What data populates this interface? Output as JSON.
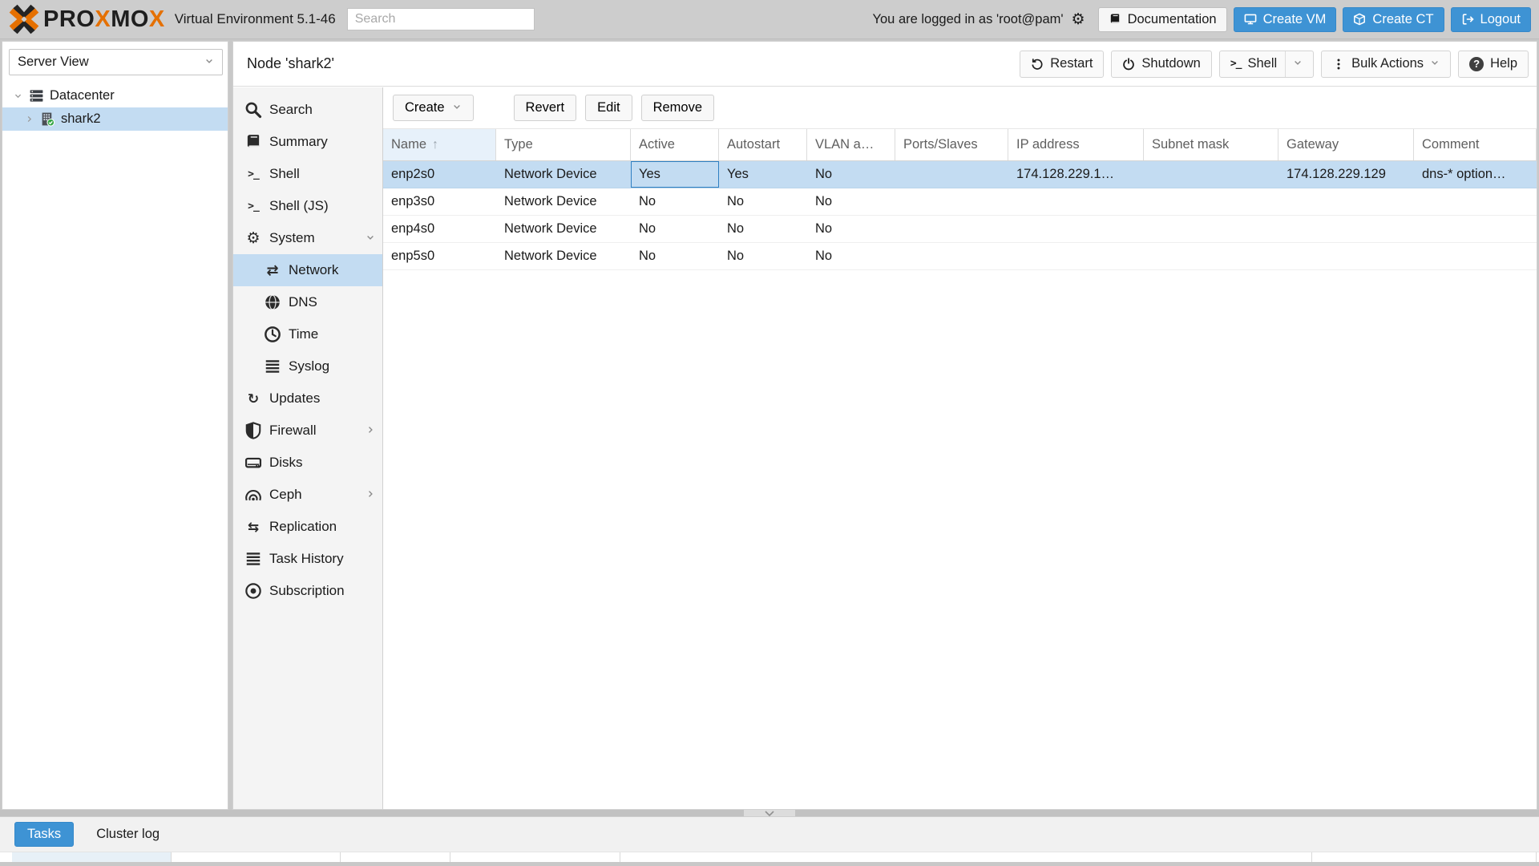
{
  "colors": {
    "orange": "#E57000",
    "button_blue": "#3E93D4",
    "selection": "#C3DCF2",
    "header_bg": "#CDCDCD"
  },
  "header": {
    "logo_segments": [
      {
        "text": "PRO",
        "color": "dark"
      },
      {
        "text": "X",
        "color": "orange"
      },
      {
        "text": "MO",
        "color": "dark"
      },
      {
        "text": "X",
        "color": "orange"
      }
    ],
    "subtitle": "Virtual Environment 5.1-46",
    "search_placeholder": "Search",
    "login_text": "You are logged in as 'root@pam'",
    "documentation_label": "Documentation",
    "create_vm_label": "Create VM",
    "create_ct_label": "Create CT",
    "logout_label": "Logout"
  },
  "tree": {
    "view_selector": "Server View",
    "items": [
      {
        "label": "Datacenter",
        "icon": "server",
        "level": 0,
        "expanded": true,
        "selected": false
      },
      {
        "label": "shark2",
        "icon": "node",
        "level": 1,
        "expanded": false,
        "selected": true
      }
    ]
  },
  "node": {
    "title": "Node 'shark2'",
    "actions": {
      "restart": "Restart",
      "shutdown": "Shutdown",
      "shell": "Shell",
      "bulk_actions": "Bulk Actions",
      "help": "Help"
    }
  },
  "menu": {
    "items": [
      {
        "label": "Search",
        "icon": "search",
        "level": 1
      },
      {
        "label": "Summary",
        "icon": "book",
        "level": 1
      },
      {
        "label": "Shell",
        "icon": "terminal",
        "level": 1
      },
      {
        "label": "Shell (JS)",
        "icon": "terminal",
        "level": 1
      },
      {
        "label": "System",
        "icon": "gear",
        "level": 1,
        "chevron": "down"
      },
      {
        "label": "Network",
        "icon": "network",
        "level": 2,
        "selected": true
      },
      {
        "label": "DNS",
        "icon": "globe",
        "level": 2
      },
      {
        "label": "Time",
        "icon": "clock",
        "level": 2
      },
      {
        "label": "Syslog",
        "icon": "list",
        "level": 2
      },
      {
        "label": "Updates",
        "icon": "refresh",
        "level": 1
      },
      {
        "label": "Firewall",
        "icon": "shield",
        "level": 1,
        "chevron": "right"
      },
      {
        "label": "Disks",
        "icon": "hdd",
        "level": 1
      },
      {
        "label": "Ceph",
        "icon": "ceph",
        "level": 1,
        "chevron": "right"
      },
      {
        "label": "Replication",
        "icon": "replication",
        "level": 1
      },
      {
        "label": "Task History",
        "icon": "list",
        "level": 1
      },
      {
        "label": "Subscription",
        "icon": "badge",
        "level": 1
      }
    ]
  },
  "toolbar": {
    "create": "Create",
    "revert": "Revert",
    "edit": "Edit",
    "remove": "Remove"
  },
  "table": {
    "columns": [
      {
        "key": "name",
        "label": "Name",
        "sorted": "asc"
      },
      {
        "key": "type",
        "label": "Type"
      },
      {
        "key": "active",
        "label": "Active"
      },
      {
        "key": "autostart",
        "label": "Autostart"
      },
      {
        "key": "vlan",
        "label": "VLAN a…"
      },
      {
        "key": "ports",
        "label": "Ports/Slaves"
      },
      {
        "key": "ip",
        "label": "IP address"
      },
      {
        "key": "subnet",
        "label": "Subnet mask"
      },
      {
        "key": "gateway",
        "label": "Gateway"
      },
      {
        "key": "comment",
        "label": "Comment"
      }
    ],
    "rows": [
      {
        "name": "enp2s0",
        "type": "Network Device",
        "active": "Yes",
        "autostart": "Yes",
        "vlan": "No",
        "ports": "",
        "ip": "174.128.229.1…",
        "subnet": "",
        "gateway": "174.128.229.129",
        "comment": "dns-* option…",
        "selected": true,
        "focus_key": "active"
      },
      {
        "name": "enp3s0",
        "type": "Network Device",
        "active": "No",
        "autostart": "No",
        "vlan": "No",
        "ports": "",
        "ip": "",
        "subnet": "",
        "gateway": "",
        "comment": ""
      },
      {
        "name": "enp4s0",
        "type": "Network Device",
        "active": "No",
        "autostart": "No",
        "vlan": "No",
        "ports": "",
        "ip": "",
        "subnet": "",
        "gateway": "",
        "comment": ""
      },
      {
        "name": "enp5s0",
        "type": "Network Device",
        "active": "No",
        "autostart": "No",
        "vlan": "No",
        "ports": "",
        "ip": "",
        "subnet": "",
        "gateway": "",
        "comment": ""
      }
    ]
  },
  "statusbar": {
    "tasks": "Tasks",
    "cluster_log": "Cluster log"
  }
}
